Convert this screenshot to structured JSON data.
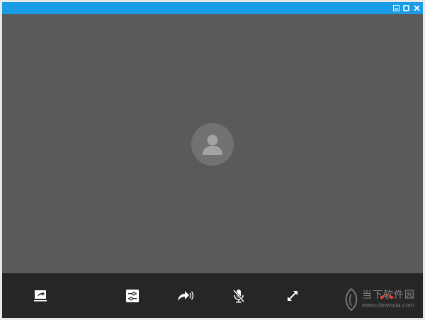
{
  "window": {
    "titlebar_color": "#1a9be6",
    "controls": [
      "minimize-icon",
      "maximize-icon",
      "close-icon"
    ]
  },
  "video": {
    "placeholder_icon": "user-avatar-icon"
  },
  "controls": {
    "items": [
      "share-screen-icon",
      "settings-sliders-icon",
      "forward-call-icon",
      "mute-microphone-icon",
      "fullscreen-icon",
      "hang-up-icon"
    ],
    "hangup_color": "#e0463c"
  },
  "watermark": {
    "name": "当下软件园",
    "url": "www.downxia.com"
  }
}
